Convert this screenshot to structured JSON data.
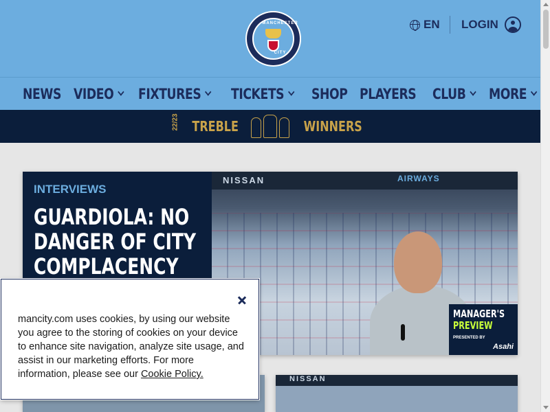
{
  "header": {
    "crest_top_text": "MANCHESTER",
    "crest_bottom_text": "CITY",
    "language": "EN",
    "login_label": "LOGIN"
  },
  "nav": {
    "items": [
      {
        "label": "NEWS",
        "has_dropdown": false
      },
      {
        "label": "VIDEO",
        "has_dropdown": true
      },
      {
        "label": "FIXTURES",
        "has_dropdown": true
      },
      {
        "label": "TICKETS",
        "has_dropdown": true
      },
      {
        "label": "SHOP",
        "has_dropdown": false
      },
      {
        "label": "PLAYERS",
        "has_dropdown": false
      },
      {
        "label": "CLUB",
        "has_dropdown": true
      },
      {
        "label": "MORE",
        "has_dropdown": true
      }
    ]
  },
  "banner": {
    "year": "22/23",
    "left_word": "TREBLE",
    "right_word": "WINNERS"
  },
  "hero": {
    "category": "INTERVIEWS",
    "title": "GUARDIOLA: NO DANGER OF CITY COMPLACENCY",
    "image": {
      "sponsor_text": "NISSAN",
      "airways_text": "AIRWAYS",
      "preview_line1": "MANAGER'S",
      "preview_line2": "PREVIEW",
      "presented_by": "PRESENTED BY",
      "brand": "Asahi"
    }
  },
  "cards": {
    "card3_sponsor": "NISSAN"
  },
  "cookie": {
    "text": "mancity.com uses cookies, by using our website you agree to the storing of cookies on your device to enhance site navigation, analyze site usage, and assist in our marketing efforts. For more information, please see our ",
    "link_label": "Cookie Policy."
  },
  "colors": {
    "sky_blue": "#6caddf",
    "navy": "#1c2c5b",
    "dark_navy": "#0b1e3b",
    "gold": "#c9a34a"
  }
}
